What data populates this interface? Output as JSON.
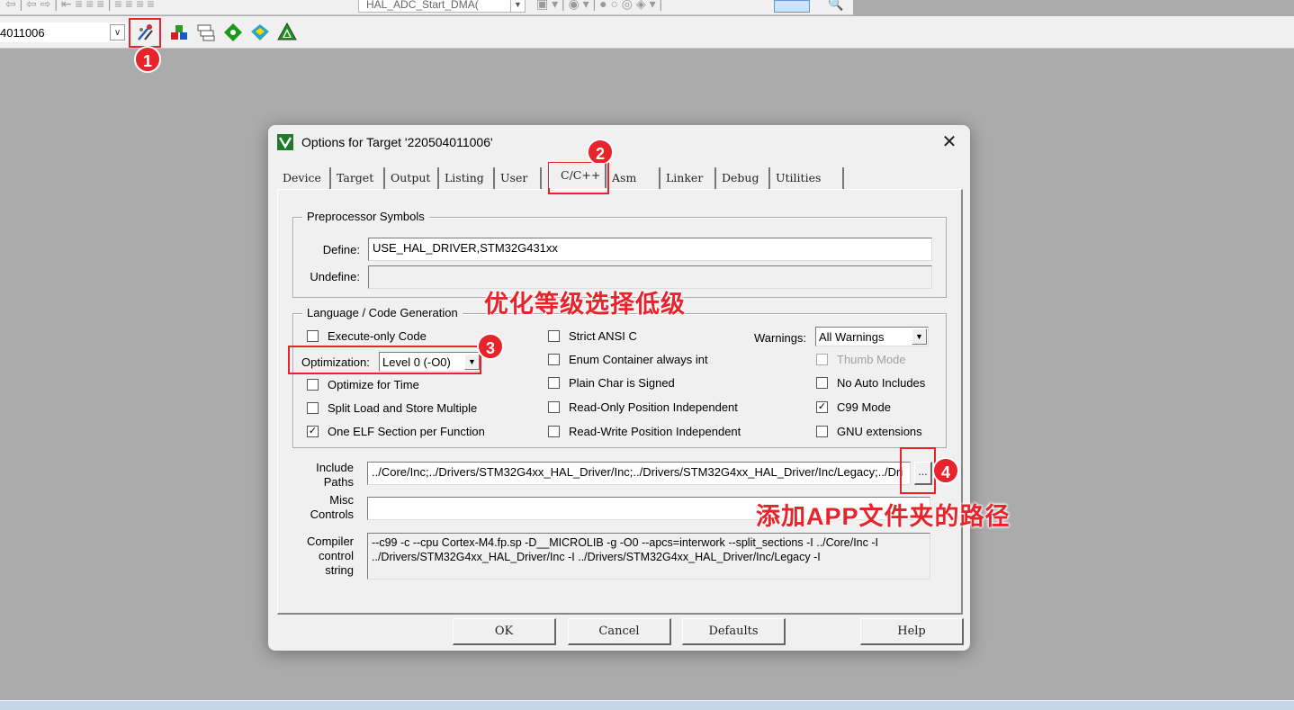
{
  "toolbar_top": {
    "function_combo": "HAL_ADC_Start_DMA("
  },
  "toolbar_build": {
    "target_value": "4011006"
  },
  "dialog": {
    "title": "Options for Target '220504011006'",
    "tabs": [
      "Device",
      "Target",
      "Output",
      "Listing",
      "User",
      "C/C++",
      "Asm",
      "Linker",
      "Debug",
      "Utilities"
    ],
    "active_tab": "C/C++",
    "preprocessor": {
      "group_title": "Preprocessor Symbols",
      "define_label": "Define:",
      "define_value": "USE_HAL_DRIVER,STM32G431xx",
      "undefine_label": "Undefine:",
      "undefine_value": ""
    },
    "language": {
      "group_title": "Language / Code Generation",
      "execute_only": {
        "label": "Execute-only Code",
        "checked": false
      },
      "optimization_label": "Optimization:",
      "optimization_value": "Level 0 (-O0)",
      "optimize_time": {
        "label": "Optimize for Time",
        "checked": false
      },
      "split_load": {
        "label": "Split Load and Store Multiple",
        "checked": false
      },
      "one_elf": {
        "label": "One ELF Section per Function",
        "checked": true
      },
      "strict_ansi": {
        "label": "Strict ANSI C",
        "checked": false
      },
      "enum_container": {
        "label": "Enum Container always int",
        "checked": false
      },
      "plain_char": {
        "label": "Plain Char is Signed",
        "checked": false
      },
      "ro_position": {
        "label": "Read-Only Position Independent",
        "checked": false
      },
      "rw_position": {
        "label": "Read-Write Position Independent",
        "checked": false
      },
      "warnings_label": "Warnings:",
      "warnings_value": "All Warnings",
      "thumb_mode": {
        "label": "Thumb Mode",
        "checked": false
      },
      "no_auto_includes": {
        "label": "No Auto Includes",
        "checked": false
      },
      "c99_mode": {
        "label": "C99 Mode",
        "checked": true
      },
      "gnu_extensions": {
        "label": "GNU extensions",
        "checked": false
      }
    },
    "include_paths_label_1": "Include",
    "include_paths_label_2": "Paths",
    "include_paths_value": "../Core/Inc;../Drivers/STM32G4xx_HAL_Driver/Inc;../Drivers/STM32G4xx_HAL_Driver/Inc/Legacy;../Dri",
    "browse_label": "...",
    "misc_label_1": "Misc",
    "misc_label_2": "Controls",
    "misc_value": "",
    "compiler_label_1": "Compiler",
    "compiler_label_2": "control",
    "compiler_label_3": "string",
    "compiler_line_1": "--c99 -c --cpu Cortex-M4.fp.sp -D__MICROLIB -g -O0 --apcs=interwork --split_sections -I ../Core/Inc -I",
    "compiler_line_2": "../Drivers/STM32G4xx_HAL_Driver/Inc -I ../Drivers/STM32G4xx_HAL_Driver/Inc/Legacy -I",
    "buttons": {
      "ok": "OK",
      "cancel": "Cancel",
      "defaults": "Defaults",
      "help": "Help"
    }
  },
  "annotations": {
    "num_1": "1",
    "num_2": "2",
    "num_3": "3",
    "num_4": "4",
    "text_optimization": "优化等级选择低级",
    "text_include": "添加APP文件夹的路径",
    "color": "#e8232a"
  }
}
